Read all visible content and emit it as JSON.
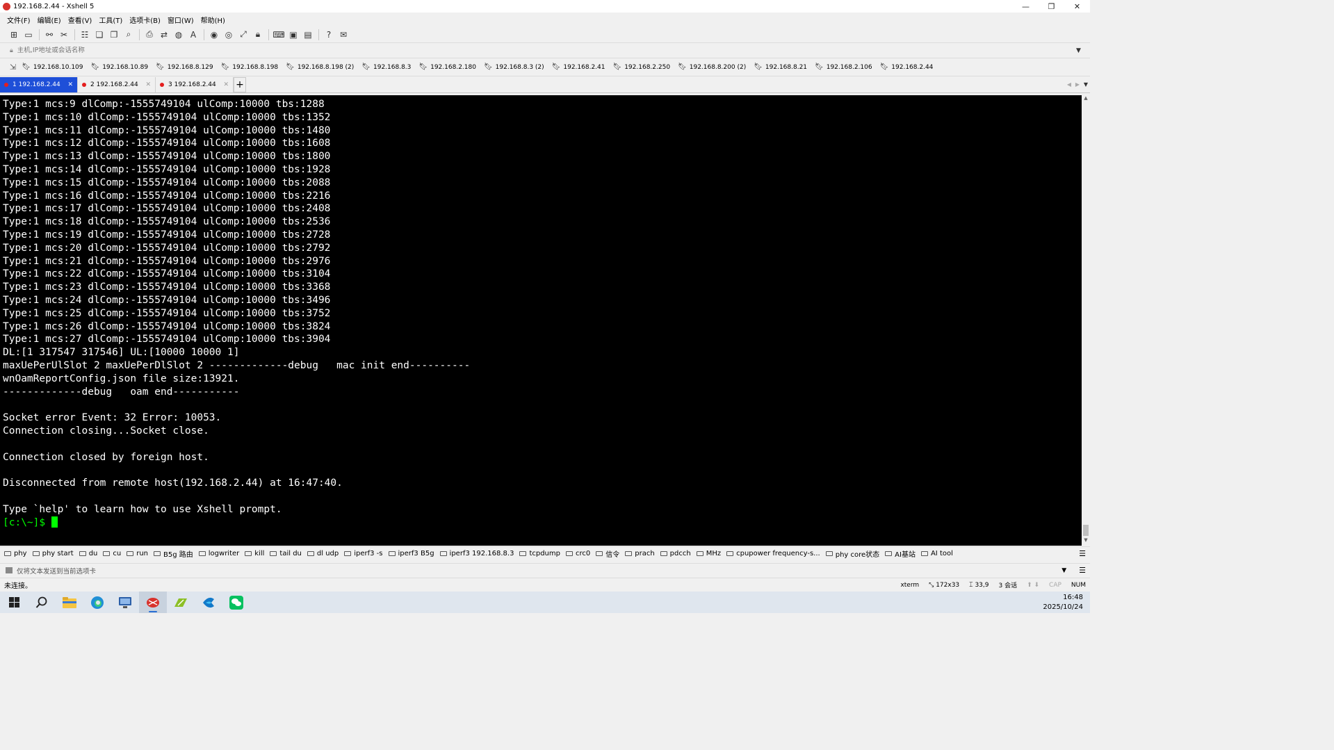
{
  "window": {
    "title": "192.168.2.44 - Xshell 5",
    "controls": {
      "minimize": "—",
      "restore": "❐",
      "close": "✕"
    }
  },
  "menu": [
    "文件(F)",
    "编辑(E)",
    "查看(V)",
    "工具(T)",
    "选项卡(B)",
    "窗口(W)",
    "帮助(H)"
  ],
  "address": {
    "placeholder": "主机,IP地址或会话名称"
  },
  "links": [
    "192.168.10.109",
    "192.168.10.89",
    "192.168.8.129",
    "192.168.8.198",
    "192.168.8.198 (2)",
    "192.168.8.3",
    "192.168.2.180",
    "192.168.8.3 (2)",
    "192.168.2.41",
    "192.168.2.250",
    "192.168.8.200 (2)",
    "192.168.8.21",
    "192.168.2.106",
    "192.168.2.44"
  ],
  "tabs": [
    {
      "num": "1",
      "label": "192.168.2.44",
      "active": true
    },
    {
      "num": "2",
      "label": "192.168.2.44",
      "active": false
    },
    {
      "num": "3",
      "label": "192.168.2.44",
      "active": false
    }
  ],
  "terminal": {
    "lines": [
      "Type:1 mcs:9 dlComp:-1555749104 ulComp:10000 tbs:1288",
      "Type:1 mcs:10 dlComp:-1555749104 ulComp:10000 tbs:1352",
      "Type:1 mcs:11 dlComp:-1555749104 ulComp:10000 tbs:1480",
      "Type:1 mcs:12 dlComp:-1555749104 ulComp:10000 tbs:1608",
      "Type:1 mcs:13 dlComp:-1555749104 ulComp:10000 tbs:1800",
      "Type:1 mcs:14 dlComp:-1555749104 ulComp:10000 tbs:1928",
      "Type:1 mcs:15 dlComp:-1555749104 ulComp:10000 tbs:2088",
      "Type:1 mcs:16 dlComp:-1555749104 ulComp:10000 tbs:2216",
      "Type:1 mcs:17 dlComp:-1555749104 ulComp:10000 tbs:2408",
      "Type:1 mcs:18 dlComp:-1555749104 ulComp:10000 tbs:2536",
      "Type:1 mcs:19 dlComp:-1555749104 ulComp:10000 tbs:2728",
      "Type:1 mcs:20 dlComp:-1555749104 ulComp:10000 tbs:2792",
      "Type:1 mcs:21 dlComp:-1555749104 ulComp:10000 tbs:2976",
      "Type:1 mcs:22 dlComp:-1555749104 ulComp:10000 tbs:3104",
      "Type:1 mcs:23 dlComp:-1555749104 ulComp:10000 tbs:3368",
      "Type:1 mcs:24 dlComp:-1555749104 ulComp:10000 tbs:3496",
      "Type:1 mcs:25 dlComp:-1555749104 ulComp:10000 tbs:3752",
      "Type:1 mcs:26 dlComp:-1555749104 ulComp:10000 tbs:3824",
      "Type:1 mcs:27 dlComp:-1555749104 ulComp:10000 tbs:3904",
      "DL:[1 317547 317546] UL:[10000 10000 1]",
      "maxUePerUlSlot 2 maxUePerDlSlot 2 -------------debug   mac init end----------",
      "wnOamReportConfig.json file size:13921.",
      "-------------debug   oam end-----------",
      "",
      "Socket error Event: 32 Error: 10053.",
      "Connection closing...Socket close.",
      "",
      "Connection closed by foreign host.",
      "",
      "Disconnected from remote host(192.168.2.44) at 16:47:40.",
      "",
      "Type `help' to learn how to use Xshell prompt."
    ],
    "prompt": "[c:\\~]$ "
  },
  "quick_commands": [
    "phy",
    "phy start",
    "du",
    "cu",
    "run",
    "B5g 路由",
    "logwriter",
    "kill",
    "tail du",
    "dl udp",
    "iperf3 -s",
    "iperf3 B5g",
    "iperf3 192.168.8.3",
    "tcpdump",
    "crc0",
    "信令",
    "prach",
    "pdcch",
    "MHz",
    "cpupower frequency-s...",
    "phy core状态",
    "AI基站",
    "AI tool"
  ],
  "send_bar": {
    "text": "仅将文本发送到当前选项卡"
  },
  "status": {
    "connection": "未连接。",
    "term": "xterm",
    "size": "172x33",
    "cursor": "33,9",
    "sessions": "3 会话",
    "cap": "CAP",
    "num": "NUM"
  },
  "clock": {
    "time": "16:48",
    "date": "2025/10/24"
  },
  "colors": {
    "tab_active": "#1e4fd8",
    "terminal_bg": "#000000",
    "prompt": "#00ff00"
  }
}
